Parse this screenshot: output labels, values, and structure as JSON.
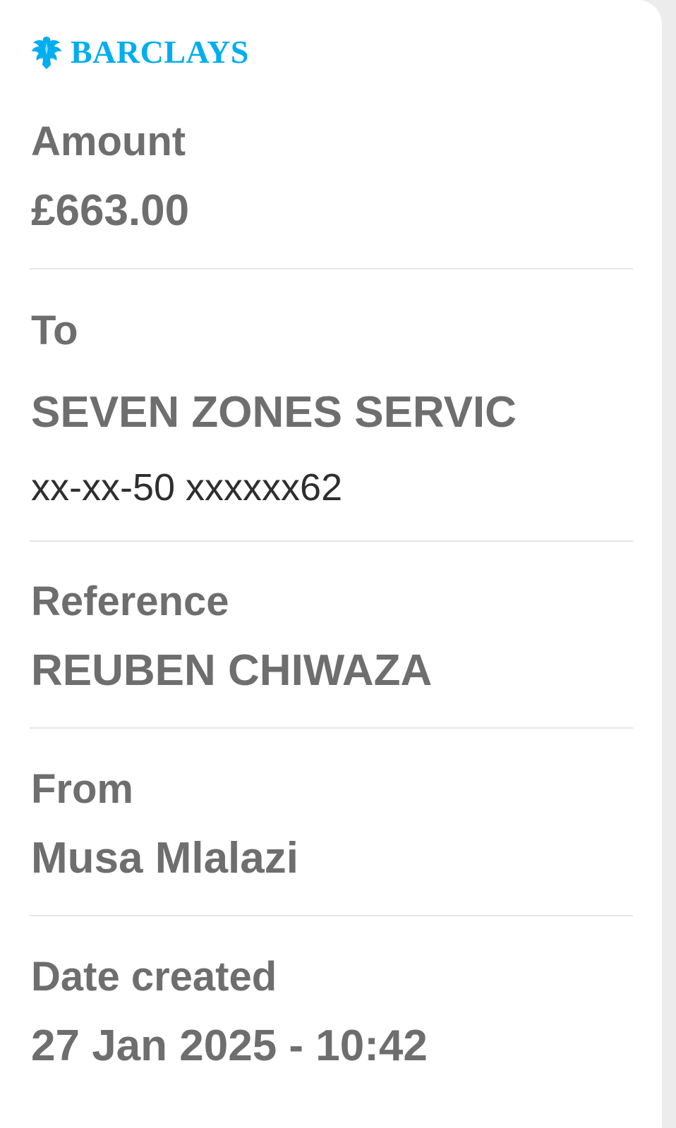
{
  "brand": {
    "name": "BARCLAYS",
    "color": "#00aeef",
    "icon": "eagle-icon"
  },
  "amount": {
    "label": "Amount",
    "value": "£663.00"
  },
  "to": {
    "label": "To",
    "name": "SEVEN ZONES SERVIC",
    "account": "xx-xx-50 xxxxxx62"
  },
  "reference": {
    "label": "Reference",
    "value": "REUBEN CHIWAZA"
  },
  "from": {
    "label": "From",
    "value": "Musa Mlalazi"
  },
  "date_created": {
    "label": "Date created",
    "value": "27 Jan 2025 - 10:42"
  },
  "colors": {
    "label_text": "#6e6e6e",
    "account_text": "#2e2e2e",
    "divider": "#e6e6e6",
    "background": "#ffffff"
  }
}
